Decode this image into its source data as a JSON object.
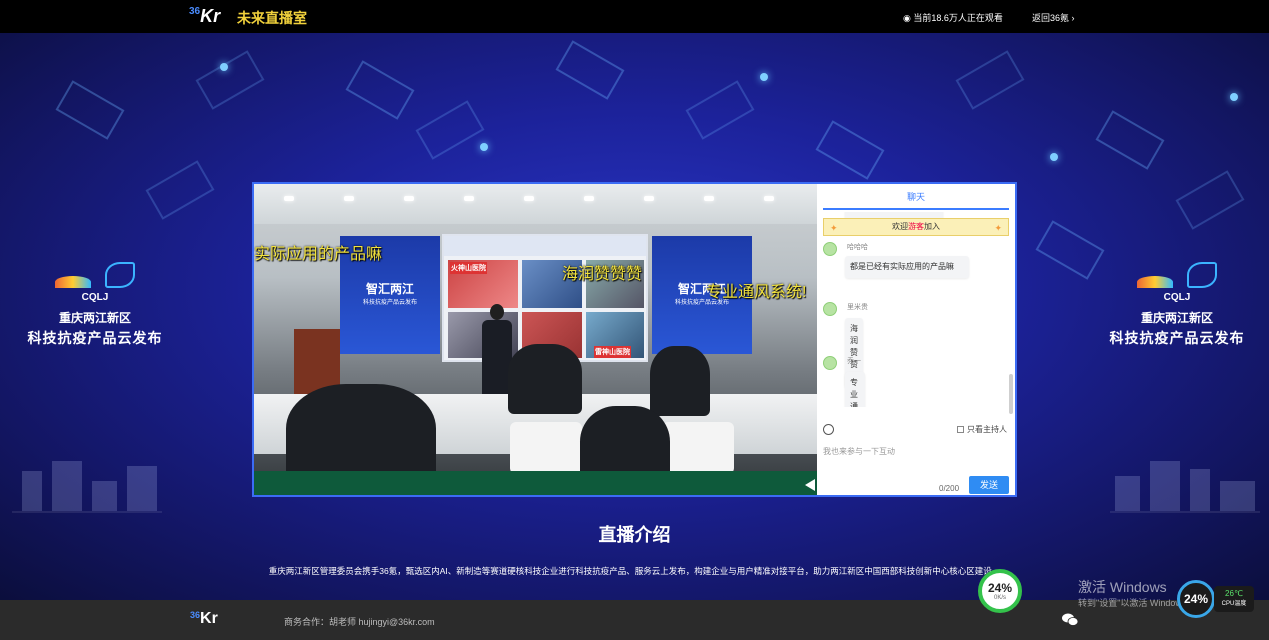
{
  "topbar": {
    "logo_sup": "36",
    "logo_text": "Kr",
    "live_title": "未来直播室",
    "viewers_text": "当前18.6万人正在观看",
    "back_link": "返回36氪"
  },
  "banner": {
    "left": {
      "cqlj": "CQLJ",
      "district": "重庆两江新区",
      "release": "科技抗疫产品云发布"
    },
    "right": {
      "cqlj": "CQLJ",
      "district": "重庆两江新区",
      "release": "科技抗疫产品云发布"
    }
  },
  "video": {
    "screen_left_title": "智汇两江",
    "screen_left_sub": "科技抗疫产品云发布",
    "screen_right_title": "智汇两江",
    "screen_right_sub": "科技抗疫产品云发布",
    "screen_center_tag1": "火神山医院",
    "screen_center_tag2": "雷神山医院",
    "danmaku": [
      "实际应用的产品嘛",
      "海润赞赞赞",
      "专业通风系统!"
    ]
  },
  "chat": {
    "tab_label": "聊天",
    "welcome_prefix": "欢迎",
    "welcome_guest": "游客",
    "welcome_suffix": "加入",
    "messages": [
      {
        "name": "哈哈哈",
        "text": "都是已经有实际应用的产品嘛"
      },
      {
        "name": "里米贵",
        "text": "海润赞赞赞"
      },
      {
        "name": "乔一",
        "text": "专业通风系统!"
      }
    ],
    "host_only_label": "只看主持人",
    "input_placeholder": "我也来参与一下互动",
    "counter": "0/200",
    "send_label": "发送"
  },
  "intro": {
    "title": "直播介绍",
    "body": "重庆两江新区管理委员会携手36氪，甄选区内AI、新制造等赛道硬核科技企业进行科技抗疫产品、服务云上发布，构建企业与用户精准对接平台，助力两江新区中国西部科技创新中心核心区建设。"
  },
  "footer": {
    "logo_sup": "36",
    "logo_text": "Kr",
    "cooperation": "商务合作：胡老师 hujingyi@36kr.com"
  },
  "overlay": {
    "net_percent": "24%",
    "net_speed": "0K/s",
    "cpu_percent": "24%",
    "cpu_temp": "26℃",
    "cpu_label": "CPU温度",
    "win_activate": "激活 Windows",
    "win_activate_sub": "转到\"设置\"以激活 Windows。"
  },
  "colors": {
    "accent": "#2f8cf3",
    "title_yellow": "#f2d23c",
    "danmaku": "#f2e23d"
  }
}
